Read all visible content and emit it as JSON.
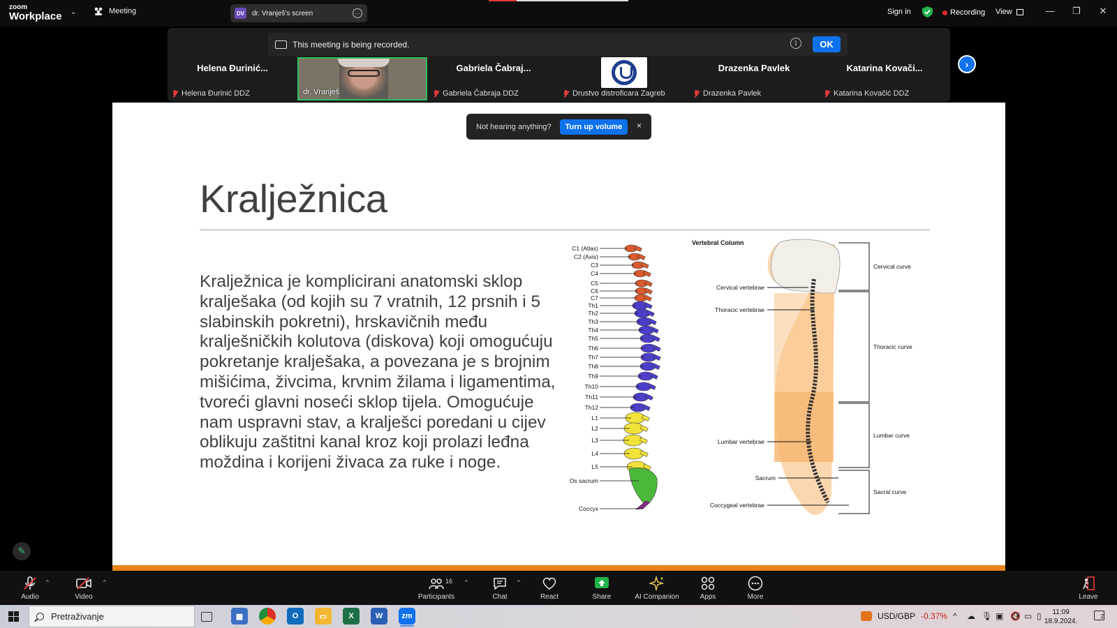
{
  "app": {
    "logo_top": "zoom",
    "logo_bottom": "Workplace",
    "meeting_label": "Meeting",
    "screen_tab": {
      "initials": "DV",
      "label": "dr. Vranješ's screen"
    },
    "sign_in": "Sign in",
    "recording_label": "Recording",
    "view_label": "View",
    "window_controls": [
      "—",
      "❐",
      "✕"
    ]
  },
  "recording_banner": {
    "text": "This meeting is being recorded.",
    "ok_label": "OK"
  },
  "participants_strip": [
    {
      "heading": "Helena  Đurinić...",
      "label": "Helena Đurinić DDZ",
      "type": "name"
    },
    {
      "heading": "",
      "label": "dr. Vranješ",
      "type": "video"
    },
    {
      "heading": "Gabriela  Čabraj...",
      "label": "Gabriela Čabraja DDZ",
      "type": "name"
    },
    {
      "heading": "",
      "label": "Drustvo distroficara Zagreb",
      "type": "logo"
    },
    {
      "heading": "Drazenka Pavlek",
      "label": "Drazenka Pavlek",
      "type": "name"
    },
    {
      "heading": "Katarina  Kovači...",
      "label": "Katarina Kovačić DDZ",
      "type": "name"
    }
  ],
  "hearing_toast": {
    "text": "Not hearing anything?",
    "button": "Turn up volume",
    "close": "×"
  },
  "slide": {
    "title": "Kralježnica",
    "body": "Kralježnica je komplicirani anatomski sklop kralješaka (od kojih su 7 vratnih, 12 prsnih i 5 slabinskih pokretni), hrskavičnih među kralješničkih kolutova (diskova) koji omogućuju pokretanje kralješaka, a povezana je s brojnim mišićima, živcima, krvnim žilama i ligamentima, tvoreći glavni noseći sklop tijela. Omogućuje nam uspravni stav, a kralješci poredani u cijev oblikuju zaštitni kanal kroz koji prolazi leđna moždina i korijeni živaca za ruke i noge.",
    "spine_labels": [
      "C1 (Atlas)",
      "C2 (Axis)",
      "C3",
      "C4",
      "C5",
      "C6",
      "C7",
      "Th1",
      "Th2",
      "Th3",
      "Th4",
      "Th5",
      "Th6",
      "Th7",
      "Th8",
      "Th9",
      "Th10",
      "Th11",
      "Th12",
      "L1",
      "L2",
      "L3",
      "L4",
      "L5",
      "Os sacrum",
      "Coccyx"
    ],
    "vertebral": {
      "title": "Vertebral Column",
      "left_labels": [
        "Cervical vertebrae",
        "Thoracic vertebrae",
        "Lumbar vertebrae",
        "Sacrum",
        "Coccygeal vertebrae"
      ],
      "right_labels": [
        "Cervical curve",
        "Thoracic curve",
        "Lumbar curve",
        "Sacral curve"
      ]
    },
    "colors": {
      "cervical": "#d85a2e",
      "thoracic": "#4b3fc9",
      "lumbar": "#f2e33a",
      "sacral": "#4cb83a",
      "coccyx": "#8a2a8a",
      "accent_bar": "#e8831a"
    }
  },
  "toolbar": {
    "audio": "Audio",
    "video": "Video",
    "participants": "Participants",
    "participants_count": "16",
    "chat": "Chat",
    "react": "React",
    "share": "Share",
    "ai_companion": "AI Companion",
    "apps": "Apps",
    "more": "More",
    "leave": "Leave"
  },
  "taskbar": {
    "search_placeholder": "Pretraživanje",
    "fx_pair": "USD/GBP",
    "fx_change": "-0.37%",
    "time": "11:09",
    "date": "18.9.2024."
  }
}
